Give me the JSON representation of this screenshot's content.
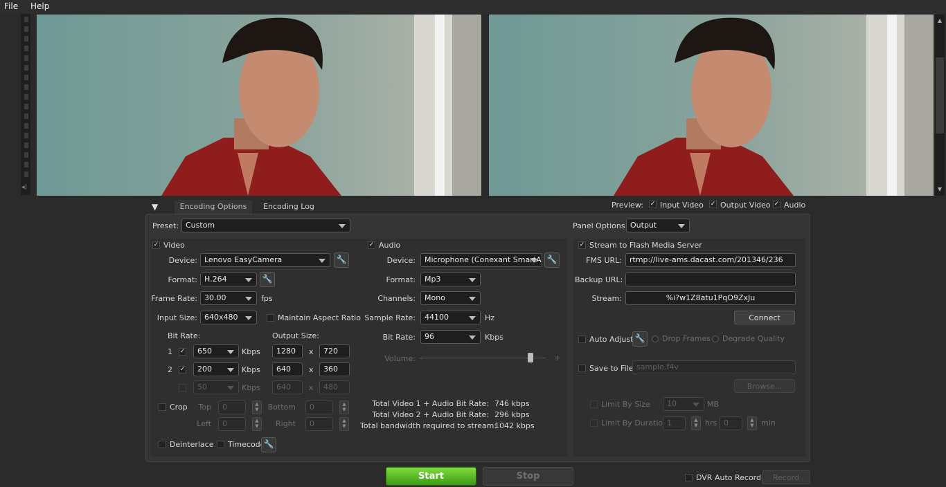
{
  "menu": {
    "file": "File",
    "help": "Help"
  },
  "tabs": {
    "encoding_options": "Encoding Options",
    "encoding_log": "Encoding Log"
  },
  "preview": {
    "label": "Preview:",
    "input_video": "Input Video",
    "output_video": "Output Video",
    "audio": "Audio"
  },
  "preset": {
    "label": "Preset:",
    "value": "Custom"
  },
  "panel_options": {
    "label": "Panel Options:",
    "value": "Output"
  },
  "video": {
    "title": "Video",
    "device_label": "Device:",
    "device": "Lenovo EasyCamera",
    "format_label": "Format:",
    "format": "H.264",
    "frame_rate_label": "Frame Rate:",
    "frame_rate": "30.00",
    "fps": "fps",
    "input_size_label": "Input Size:",
    "input_size": "640x480",
    "maintain_aspect": "Maintain Aspect Ratio",
    "bit_rate_label": "Bit Rate:",
    "output_size_label": "Output Size:",
    "rows": [
      {
        "idx": "1",
        "bitrate": "650",
        "unit": "Kbps",
        "w": "1280",
        "x": "x",
        "h": "720"
      },
      {
        "idx": "2",
        "bitrate": "200",
        "unit": "Kbps",
        "w": "640",
        "x": "x",
        "h": "360"
      },
      {
        "idx": "",
        "bitrate": "50",
        "unit": "Kbps",
        "w": "640",
        "x": "x",
        "h": "480"
      }
    ],
    "crop": "Crop",
    "top": "Top",
    "bottom": "Bottom",
    "left": "Left",
    "right": "Right",
    "top_val": "0",
    "bottom_val": "0",
    "left_val": "0",
    "right_val": "0",
    "deinterlace": "Deinterlace",
    "timecode": "Timecode"
  },
  "audio": {
    "title": "Audio",
    "device_label": "Device:",
    "device": "Microphone (Conexant SmartAu",
    "format_label": "Format:",
    "format": "Mp3",
    "channels_label": "Channels:",
    "channels": "Mono",
    "sample_rate_label": "Sample Rate:",
    "sample_rate": "44100",
    "hz": "Hz",
    "bit_rate_label": "Bit Rate:",
    "bit_rate": "96",
    "kbps": "Kbps",
    "volume_label": "Volume:",
    "minus": "-",
    "plus": "+",
    "volume_level": 0.88
  },
  "totals": {
    "v1_label": "Total Video 1 + Audio Bit Rate:",
    "v1": "746 kbps",
    "v2_label": "Total Video 2 + Audio Bit Rate:",
    "v2": "296 kbps",
    "bw_label": "Total bandwidth required to stream:",
    "bw": "1042 kbps"
  },
  "stream": {
    "title": "Stream to Flash Media Server",
    "fms_url_label": "FMS URL:",
    "fms_url": "rtmp://live-ams.dacast.com/201346/236",
    "backup_url_label": "Backup URL:",
    "backup_url": "",
    "stream_label": "Stream:",
    "stream": "%i?w1Z8atu1PqO9ZxJu",
    "connect": "Connect",
    "auto_adjust": "Auto Adjust",
    "drop_frames": "Drop Frames",
    "degrade_quality": "Degrade Quality",
    "save_to_file": "Save to File",
    "file_name": "sample.f4v",
    "browse": "Browse...",
    "limit_by_size": "Limit By Size",
    "size_value": "10",
    "mb": "MB",
    "limit_by_duration": "Limit By Duration",
    "hrs_value": "1",
    "hrs": "hrs",
    "min_value": "0",
    "min": "min"
  },
  "controls": {
    "start": "Start",
    "stop": "Stop",
    "dvr_auto_record": "DVR Auto Record",
    "record": "Record"
  }
}
